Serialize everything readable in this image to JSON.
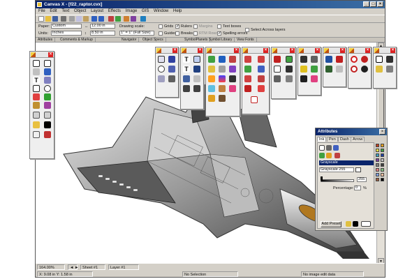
{
  "window": {
    "title": "Canvas X - [f22_raptor.cvx]"
  },
  "menu": [
    "File",
    "Edit",
    "Text",
    "Object",
    "Layout",
    "Effects",
    "Image",
    "GIS",
    "Window",
    "Help"
  ],
  "propbar": {
    "paper_label": "Paper:",
    "paper_value": "Custom",
    "units_label": "Units:",
    "units_value": "Inches",
    "width_value": "12.00 in",
    "height_value": "8.50 in",
    "drawing_scale_label": "Drawing scale:",
    "drawing_scale_value": "1\" = 1\" (Full Size)",
    "grids_label": "Grids",
    "guides_label": "Guides",
    "rulers_label": "Rulers",
    "breaks_label": "Breaks",
    "margins_label": "Margins",
    "rows_label": "RTM Rows",
    "textboxes_label": "Text boxes",
    "spelling_label": "Spelling errors",
    "select_layers_label": "Select Across layers"
  },
  "dock_tabs": [
    "Attributes",
    "Comments & Markup",
    "Navigator",
    "Object Specs",
    "SymbolPlanets",
    "Symbol Library",
    "View Fonts"
  ],
  "attributes": {
    "title": "Attributes",
    "tabs": [
      "Ink",
      "Pen",
      "Dash",
      "Arrow"
    ],
    "section": "Grayscale",
    "value_field": "Grayscale 255",
    "slider_value": "255",
    "percentage_label": "Percentage:",
    "percentage_value": "0",
    "percent_sign": "%",
    "add_preset_label": "Add Preset",
    "colors": [
      "#c04020",
      "#e8a020",
      "#f0e040",
      "#40a040",
      "#40a0c0",
      "#2040a0",
      "#8040a0",
      "#c0c0c0",
      "#808080",
      "#404040",
      "#e08080",
      "#80c080",
      "#80a0e0",
      "#f0c0a0",
      "#a06040",
      "#000000"
    ]
  },
  "status": {
    "zoom": "164.00%",
    "page": "Sheet #1",
    "layer": "Layer #1",
    "coords": "X: 9.08 in   Y: 1.58 in",
    "selection": "No Selection",
    "image_edit": "No image edit data"
  },
  "colors": {
    "titlebar": "#0a246a",
    "close": "#dd2222",
    "chrome": "#d4d0c8"
  }
}
